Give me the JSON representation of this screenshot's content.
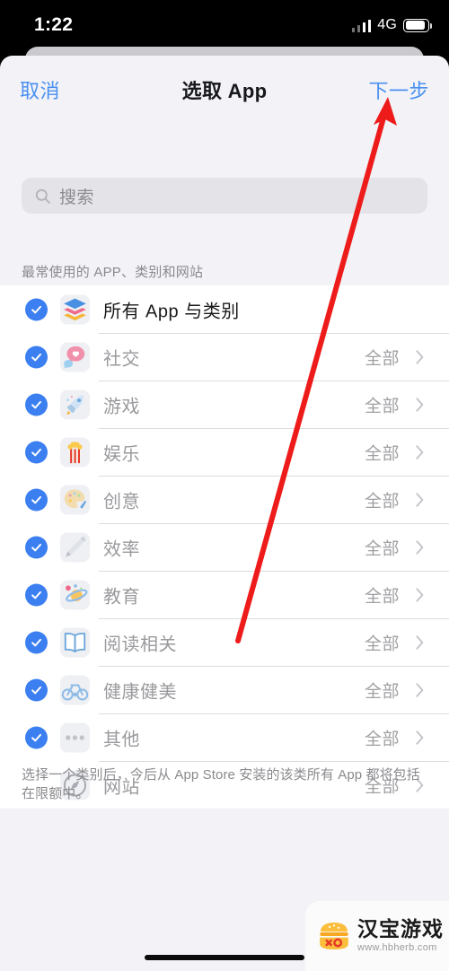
{
  "status_bar": {
    "time": "1:22",
    "network": "4G",
    "signal_icon": "signal-bars-icon",
    "battery_icon": "battery-icon"
  },
  "nav": {
    "cancel_label": "取消",
    "title": "选取 App",
    "next_label": "下一步"
  },
  "search": {
    "placeholder": "搜索",
    "value": "",
    "icon": "search-icon"
  },
  "section": {
    "header": "最常使用的 APP、类别和网站"
  },
  "list": {
    "value_label": "全部",
    "rows": [
      {
        "label": "所有 App 与类别",
        "checked": true,
        "icon": "layers-stack-icon",
        "value": "",
        "chevron": false,
        "primary": true
      },
      {
        "label": "社交",
        "checked": true,
        "icon": "chat-heart-icon",
        "value": "全部",
        "chevron": true,
        "primary": false
      },
      {
        "label": "游戏",
        "checked": true,
        "icon": "rocket-icon",
        "value": "全部",
        "chevron": true,
        "primary": false
      },
      {
        "label": "娱乐",
        "checked": true,
        "icon": "popcorn-icon",
        "value": "全部",
        "chevron": true,
        "primary": false
      },
      {
        "label": "创意",
        "checked": true,
        "icon": "palette-icon",
        "value": "全部",
        "chevron": true,
        "primary": false
      },
      {
        "label": "效率",
        "checked": true,
        "icon": "pen-icon",
        "value": "全部",
        "chevron": true,
        "primary": false
      },
      {
        "label": "教育",
        "checked": true,
        "icon": "planet-icon",
        "value": "全部",
        "chevron": true,
        "primary": false
      },
      {
        "label": "阅读相关",
        "checked": true,
        "icon": "book-icon",
        "value": "全部",
        "chevron": true,
        "primary": false
      },
      {
        "label": "健康健美",
        "checked": true,
        "icon": "bicycle-icon",
        "value": "全部",
        "chevron": true,
        "primary": false
      },
      {
        "label": "其他",
        "checked": true,
        "icon": "ellipsis-icon",
        "value": "全部",
        "chevron": true,
        "primary": false
      },
      {
        "label": "网站",
        "checked": false,
        "icon": "compass-icon",
        "value": "全部",
        "chevron": true,
        "primary": false
      }
    ]
  },
  "footnote": {
    "text": "选择一个类别后，今后从 App Store 安装的该类所有 App 都将包括在限额中。"
  },
  "annotation": {
    "arrow_color": "#ee1b1b",
    "points_to": "下一步"
  },
  "watermark": {
    "title": "汉宝游戏",
    "url": "www.hbherb.com",
    "logo_icon": "burger-logo-icon"
  },
  "colors": {
    "accent": "#4a90f0",
    "check": "#3b7ff0",
    "sheet_bg": "#f2f2f7",
    "row_bg": "#ffffff",
    "muted_text": "#9a9a9e"
  }
}
